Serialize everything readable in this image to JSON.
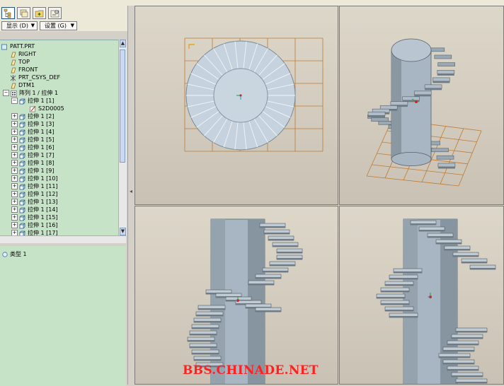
{
  "toolbar": {
    "buttons": [
      "model-tree-icon",
      "layer-icon",
      "add-folder-icon",
      "settings-icon"
    ]
  },
  "menus": {
    "show_label": "显示 (D)",
    "settings_label": "设置 (G)"
  },
  "tree": {
    "root": "PATT.PRT",
    "datums": [
      "RIGHT",
      "TOP",
      "FRONT"
    ],
    "csys": "PRT_CSYS_DEF",
    "sketch_datum": "DTM1",
    "pattern": "阵列 1 / 拉伸 1",
    "first_member": "拉伸 1 [1]",
    "first_sketch": "S2D0005",
    "members": [
      "拉伸 1 [2]",
      "拉伸 1 [3]",
      "拉伸 1 [4]",
      "拉伸 1 [5]",
      "拉伸 1 [6]",
      "拉伸 1 [7]",
      "拉伸 1 [8]",
      "拉伸 1 [9]",
      "拉伸 1 [10]",
      "拉伸 1 [11]",
      "拉伸 1 [12]",
      "拉伸 1 [13]",
      "拉伸 1 [14]",
      "拉伸 1 [15]",
      "拉伸 1 [16]",
      "拉伸 1 [17]"
    ]
  },
  "lower_pane": {
    "item": "类型 1"
  },
  "watermark": "BBS.CHINADE.NET",
  "colors": {
    "tree_bg": "#c7e3c7",
    "part_fill": "#a7b6c2",
    "part_dark": "#6f7c86",
    "grid": "#c07a30",
    "viewport_bg": "#d6d0c2"
  }
}
